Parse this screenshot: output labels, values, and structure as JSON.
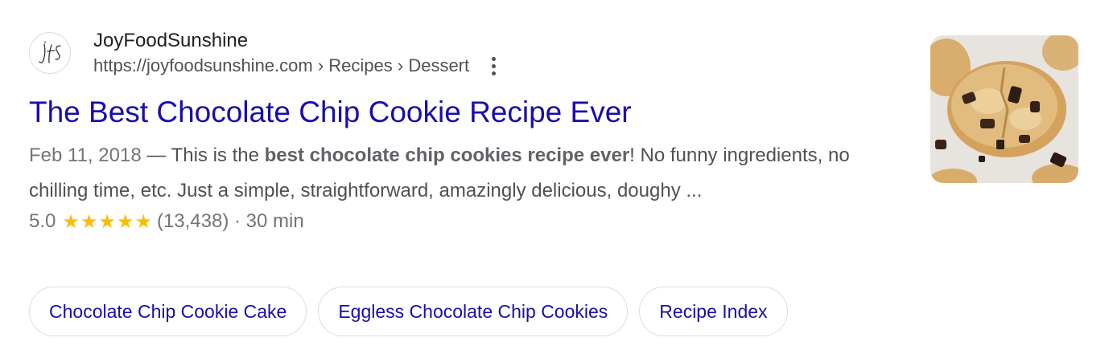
{
  "result": {
    "site_name": "JoyFoodSunshine",
    "favicon_icon": "jfs-monogram-logo",
    "url": {
      "base": "https://joyfoodsunshine.com",
      "separator": " › ",
      "crumbs": [
        "Recipes",
        "Dessert"
      ]
    },
    "more_icon": "vertical-dots-icon",
    "title": "The Best Chocolate Chip Cookie Recipe Ever",
    "snippet": {
      "date": "Feb 11, 2018",
      "dash": " — ",
      "before_bold": "This is the ",
      "bold": "best chocolate chip cookies recipe ever",
      "after_bold": "! No funny ingredients, no chilling time, etc. Just a simple, straightforward, amazingly delicious, doughy ..."
    },
    "rating": {
      "value": "5.0",
      "stars": 5,
      "star_icon": "star-icon",
      "count": "(13,438)",
      "separator": " · ",
      "time": "30 min"
    },
    "chips": [
      {
        "label": "Chocolate Chip Cookie Cake"
      },
      {
        "label": "Eggless Chocolate Chip Cookies"
      },
      {
        "label": "Recipe Index"
      }
    ],
    "thumbnail": "chocolate-chip-cookie-photo"
  },
  "colors": {
    "link": "#1a0dab",
    "text": "#4d5156",
    "star": "#fbbc04",
    "border": "#dadce0"
  }
}
